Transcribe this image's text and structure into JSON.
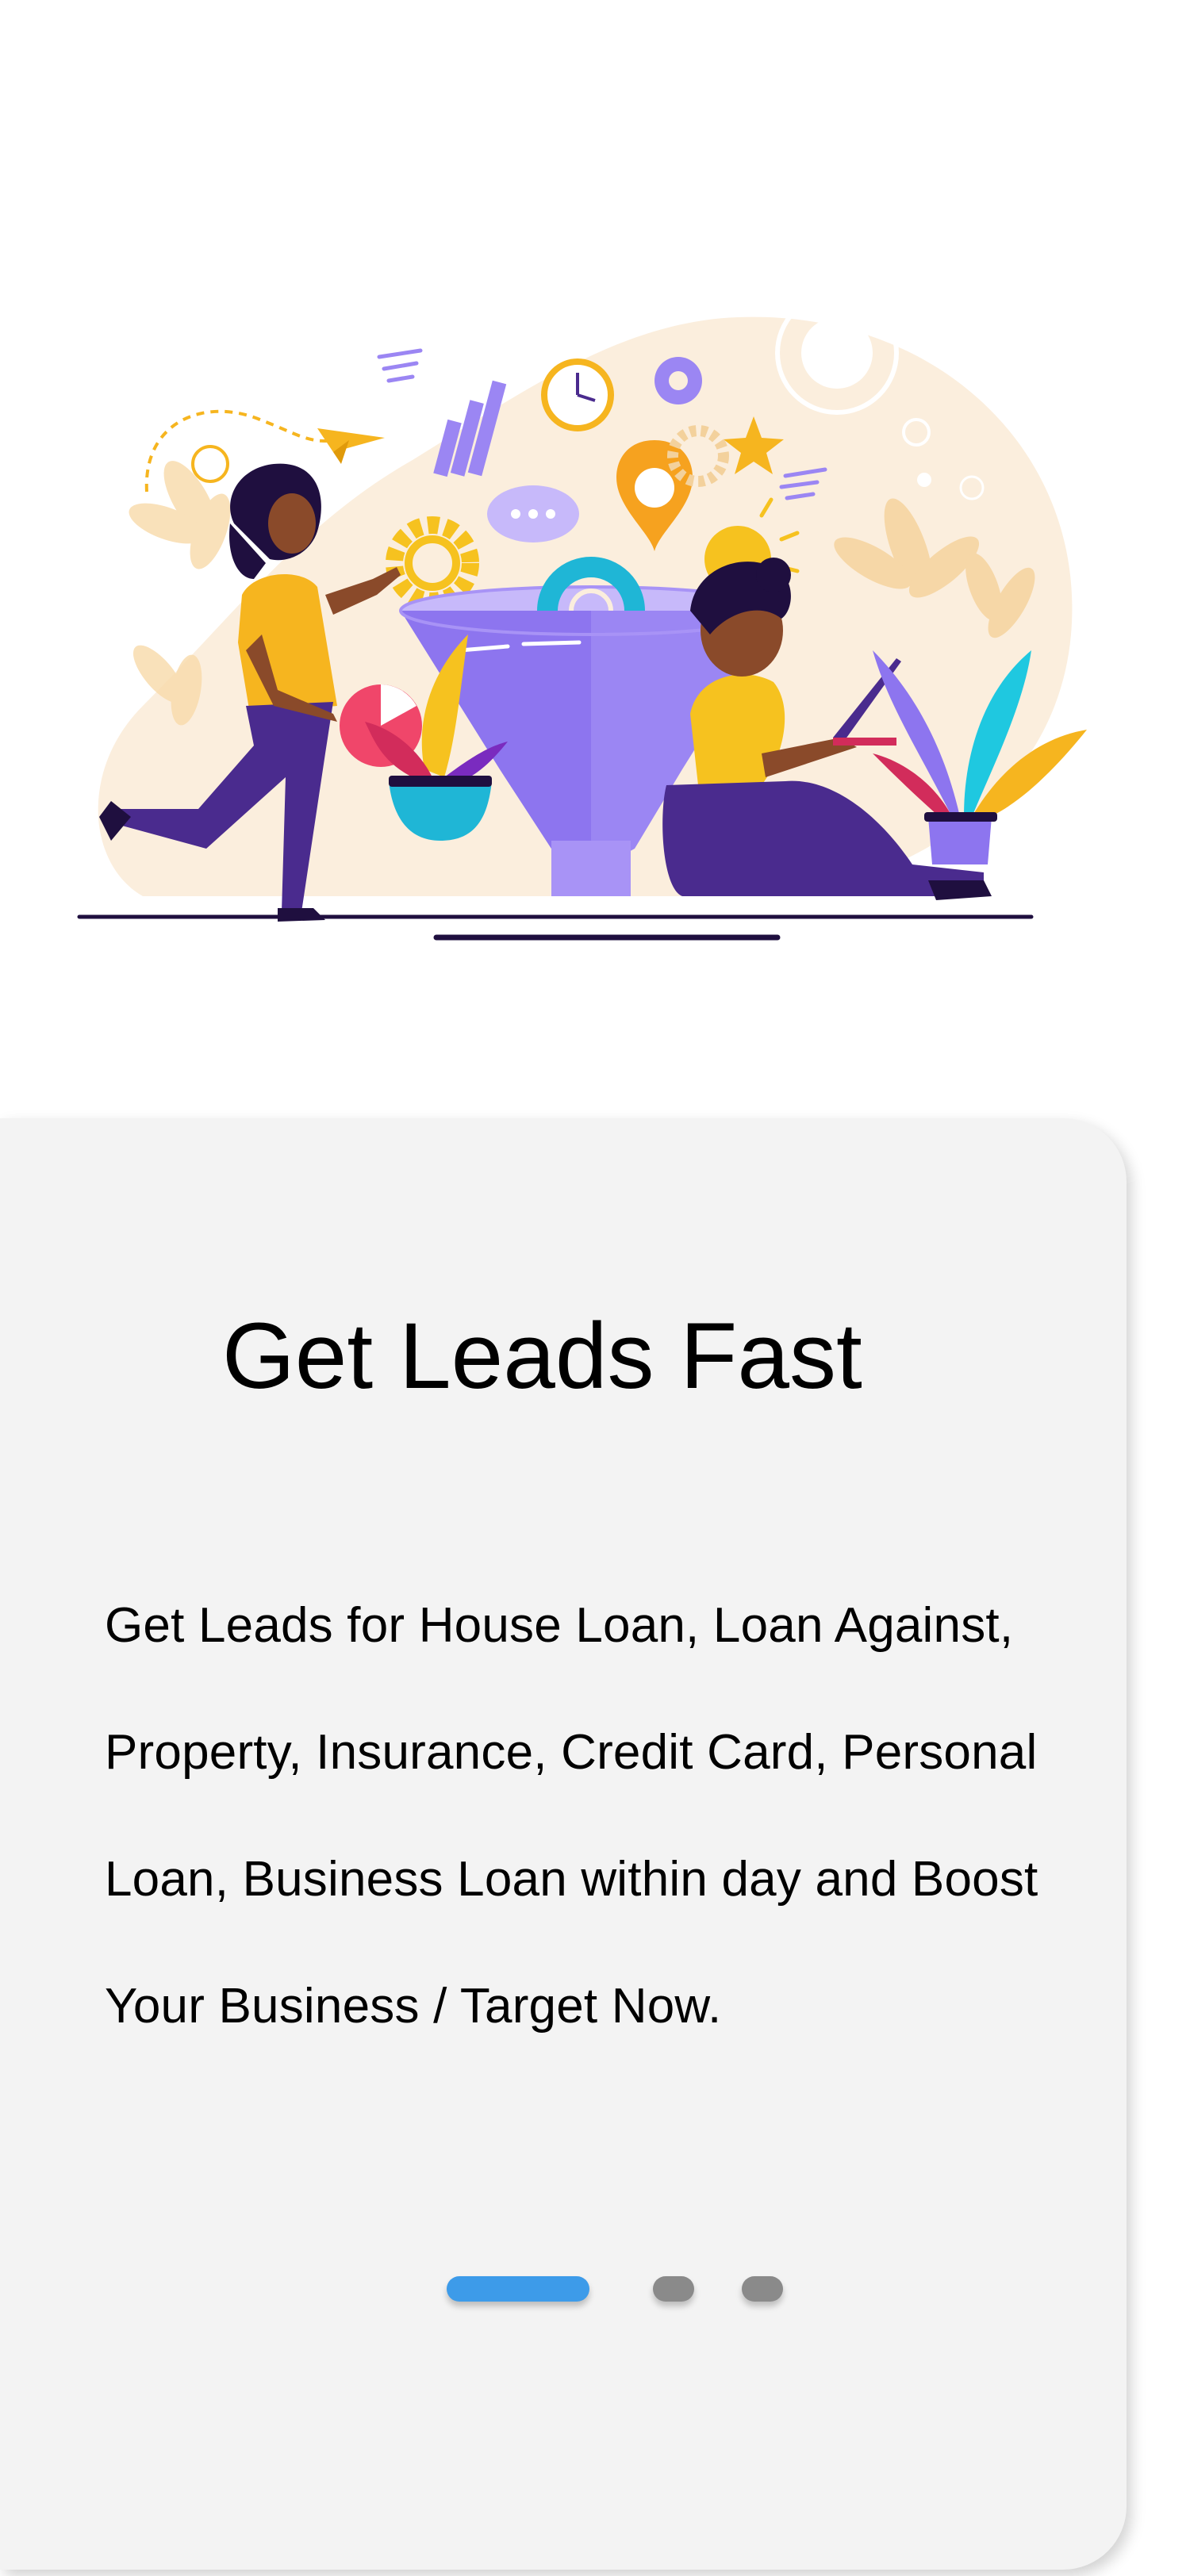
{
  "onboarding": {
    "title": "Get Leads Fast",
    "description": "Get Leads for House Loan, Loan Against, Property, Insurance, Credit Card, Personal Loan, Business Loan within day and Boost Your Business / Target Now.",
    "pages_total": 3,
    "current_page": 1
  },
  "illustration": {
    "icon": "lead-funnel-illustration-icon",
    "colors": {
      "funnel": "#9b86f3",
      "backdrop": "#fbeedd",
      "accent_yellow": "#f6b51f",
      "purple": "#4a2b8e",
      "teal": "#1fb6d6",
      "pink": "#f0466a"
    }
  },
  "colors": {
    "card_background": "#f3f3f3",
    "active_dot": "#3d9be9",
    "inactive_dot": "#8a8a8a"
  }
}
